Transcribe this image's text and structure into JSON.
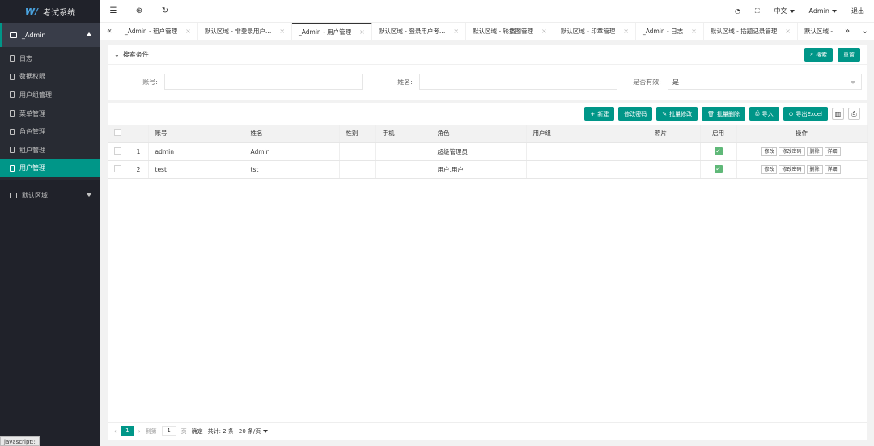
{
  "app": {
    "title": "考试系统",
    "logo_mark": "W/"
  },
  "sidebar": {
    "group_active": "_Admin",
    "items": [
      {
        "label": "日志"
      },
      {
        "label": "数据权限"
      },
      {
        "label": "用户组管理"
      },
      {
        "label": "菜单管理"
      },
      {
        "label": "角色管理"
      },
      {
        "label": "租户管理"
      },
      {
        "label": "用户管理"
      }
    ],
    "group_other": "默认区域",
    "status": "javascript:;"
  },
  "header": {
    "language": "中文",
    "user": "Admin",
    "logout": "退出"
  },
  "tabs": [
    {
      "label": "_Admin - 租户管理"
    },
    {
      "label": "默认区域 - 非登录用户…"
    },
    {
      "label": "_Admin - 用户管理"
    },
    {
      "label": "默认区域 - 登录用户考…"
    },
    {
      "label": "默认区域 - 轮播图管理"
    },
    {
      "label": "默认区域 - 印章管理"
    },
    {
      "label": "_Admin - 日志"
    },
    {
      "label": "默认区域 - 插题记录管理"
    },
    {
      "label": "默认区域 -"
    }
  ],
  "search": {
    "title": "搜索条件",
    "search_btn": "搜索",
    "reset_btn": "重置",
    "account_label": "账号:",
    "account_value": "",
    "name_label": "姓名:",
    "name_value": "",
    "valid_label": "是否有效:",
    "valid_value": "是"
  },
  "toolbar": {
    "new": "新建",
    "change_pwd": "修改密码",
    "batch_edit": "批量修改",
    "batch_delete": "批量删除",
    "import": "导入",
    "export": "导出Excel"
  },
  "table": {
    "headers": {
      "account": "账号",
      "name": "姓名",
      "gender": "性别",
      "phone": "手机",
      "role": "角色",
      "group": "用户组",
      "photo": "照片",
      "enabled": "启用",
      "ops": "操作"
    },
    "rows": [
      {
        "no": "1",
        "account": "admin",
        "name": "Admin",
        "gender": "",
        "phone": "",
        "role": "超级管理员",
        "group": "",
        "photo": "",
        "enabled": true
      },
      {
        "no": "2",
        "account": "test",
        "name": "tst",
        "gender": "",
        "phone": "",
        "role": "用户,用户",
        "group": "",
        "photo": "",
        "enabled": true
      }
    ],
    "ops": {
      "edit": "修改",
      "change_pwd": "修改密码",
      "delete": "删除",
      "detail": "详细"
    }
  },
  "pager": {
    "current": "1",
    "goto_label": "到第",
    "goto_value": "1",
    "page_unit": "页",
    "confirm": "确定",
    "total": "共计: 2 条",
    "per_page": "20 条/页"
  }
}
